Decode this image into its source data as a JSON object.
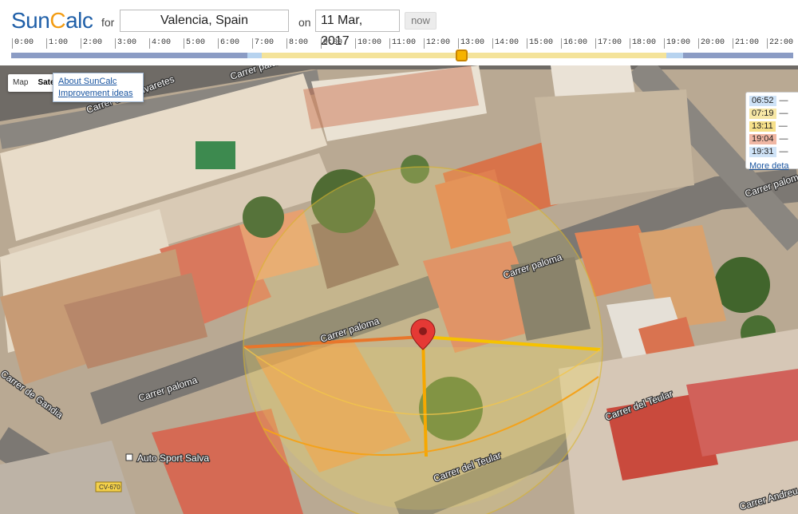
{
  "app": {
    "logo_prefix": "Sun",
    "logo_c": "C",
    "logo_suffix": "alc",
    "for_label": "for",
    "on_label": "on",
    "place": "Valencia, Spain",
    "date": "11 Mar, 2017",
    "now_label": "now"
  },
  "timeline": {
    "ticks": [
      "0:00",
      "1:00",
      "2:00",
      "3:00",
      "4:00",
      "5:00",
      "6:00",
      "7:00",
      "8:00",
      "9:00",
      "10:00",
      "11:00",
      "12:00",
      "13:00",
      "14:00",
      "15:00",
      "16:00",
      "17:00",
      "18:00",
      "19:00",
      "20:00",
      "21:00",
      "22:00"
    ],
    "current_time": "13:00",
    "colors": {
      "night": "#8b9cc4",
      "twilight": "#b7d3ef",
      "day": "#f4e39a",
      "handle": "#f6b300"
    }
  },
  "map": {
    "type_options": [
      "Map",
      "Satellite"
    ],
    "selected_type": "Satellite",
    "about_link": "About SunCalc",
    "improve_link": "Improvement ideas",
    "streets": [
      "Carrer de l' Olivaretes",
      "Carrer paloma",
      "Carrer paloma",
      "Carrer paloma",
      "Carrer de Gandia",
      "Carrer del Teular",
      "Carrer del Teular",
      "Carrer paloma",
      "Carrer Andreu",
      "Auto Sport Salva",
      "CV-670"
    ]
  },
  "legend": {
    "times": [
      {
        "time": "06:52",
        "color": "#cfe3f7"
      },
      {
        "time": "07:19",
        "color": "#f7e7a5"
      },
      {
        "time": "13:11",
        "color": "#f6e08a"
      },
      {
        "time": "19:04",
        "color": "#f0b7a4"
      },
      {
        "time": "19:31",
        "color": "#cfe3f7"
      }
    ],
    "dash": "—",
    "more_link": "More deta"
  },
  "sun_lines": {
    "sunrise_color": "#f6c200",
    "sunset_color": "#e8762b",
    "current_color": "#f6a800",
    "noon_color": "#f1c21f"
  }
}
